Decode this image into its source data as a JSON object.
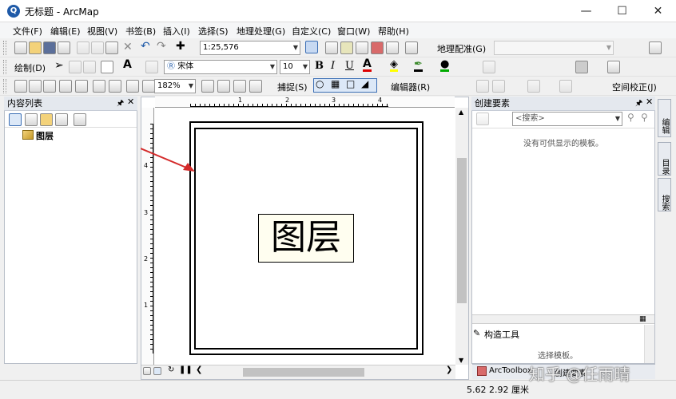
{
  "window": {
    "title": "无标题 - ArcMap",
    "app_icon_letter": "Q"
  },
  "menu": [
    "文件(F)",
    "编辑(E)",
    "视图(V)",
    "书签(B)",
    "插入(I)",
    "选择(S)",
    "地理处理(G)",
    "自定义(C)",
    "窗口(W)",
    "帮助(H)"
  ],
  "toolbar1": {
    "scale": "1:25,576",
    "georef_label": "地理配准(G)"
  },
  "toolbar2": {
    "draw_label": "绘制(D)",
    "font": "宋体",
    "font_size": "10",
    "bold": "B",
    "italic": "I",
    "underline": "U",
    "text_tool": "A"
  },
  "toolbar3": {
    "zoom": "182%",
    "snap_label": "捕捉(S)",
    "editor_label": "编辑器(R)",
    "spatial_adjust_label": "空间校正(J)"
  },
  "toc": {
    "title": "内容列表",
    "layer": "图层"
  },
  "create_features": {
    "title": "创建要素",
    "search_placeholder": "<搜索>",
    "empty_msg": "没有可供显示的模板。",
    "construct_title": "构造工具",
    "construct_msg": "选择模板。",
    "arctoolbox": "ArcToolbox",
    "create_features_tab": "创建要素"
  },
  "side_tabs": [
    "编辑",
    "目录",
    "搜索"
  ],
  "layout": {
    "frame_label": "图层",
    "ruler_labels": [
      "1",
      "2",
      "3",
      "4"
    ],
    "vruler_labels": [
      "4",
      "3",
      "2",
      "1"
    ]
  },
  "status": {
    "coords": "5.62  2.92 厘米"
  },
  "watermark": "知乎 @任雨晴",
  "colors": {
    "arrow": "#d42a2a",
    "accent": "#1f5aa8"
  }
}
